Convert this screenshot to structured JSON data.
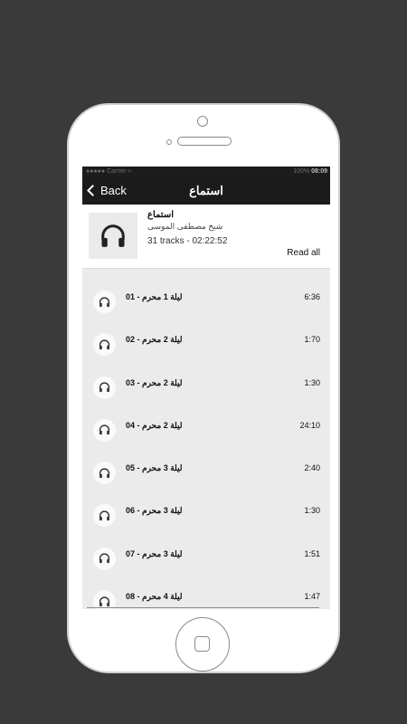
{
  "status_bar": {
    "carrier": "●●●●● Carrier ≈",
    "battery": "100%",
    "time": "08:09"
  },
  "nav": {
    "back_label": "Back",
    "title": "استماع"
  },
  "album": {
    "title": "استماع",
    "author": "شيخ مصطفى الموسى",
    "tracks_info": "31 tracks - 02:22:52",
    "read_all_label": "Read all",
    "icon": "headphones-icon"
  },
  "tracks": [
    {
      "name": "ليلة 1 محرم - 01",
      "duration": "6:36"
    },
    {
      "name": "ليلة 2 محرم - 02",
      "duration": "1:70"
    },
    {
      "name": "ليلة 2 محرم - 03",
      "duration": "1:30"
    },
    {
      "name": "ليلة 2 محرم - 04",
      "duration": "24:10"
    },
    {
      "name": "ليلة 3 محرم - 05",
      "duration": "2:40"
    },
    {
      "name": "ليلة 3 محرم - 06",
      "duration": "1:30"
    },
    {
      "name": "ليلة 3 محرم - 07",
      "duration": "1:51"
    },
    {
      "name": "ليلة 4 محرم - 08",
      "duration": "1:47"
    }
  ],
  "colors": {
    "background": "#3a3a3a",
    "navbar": "#1b1b1b",
    "list_bg": "#ebebeb"
  }
}
